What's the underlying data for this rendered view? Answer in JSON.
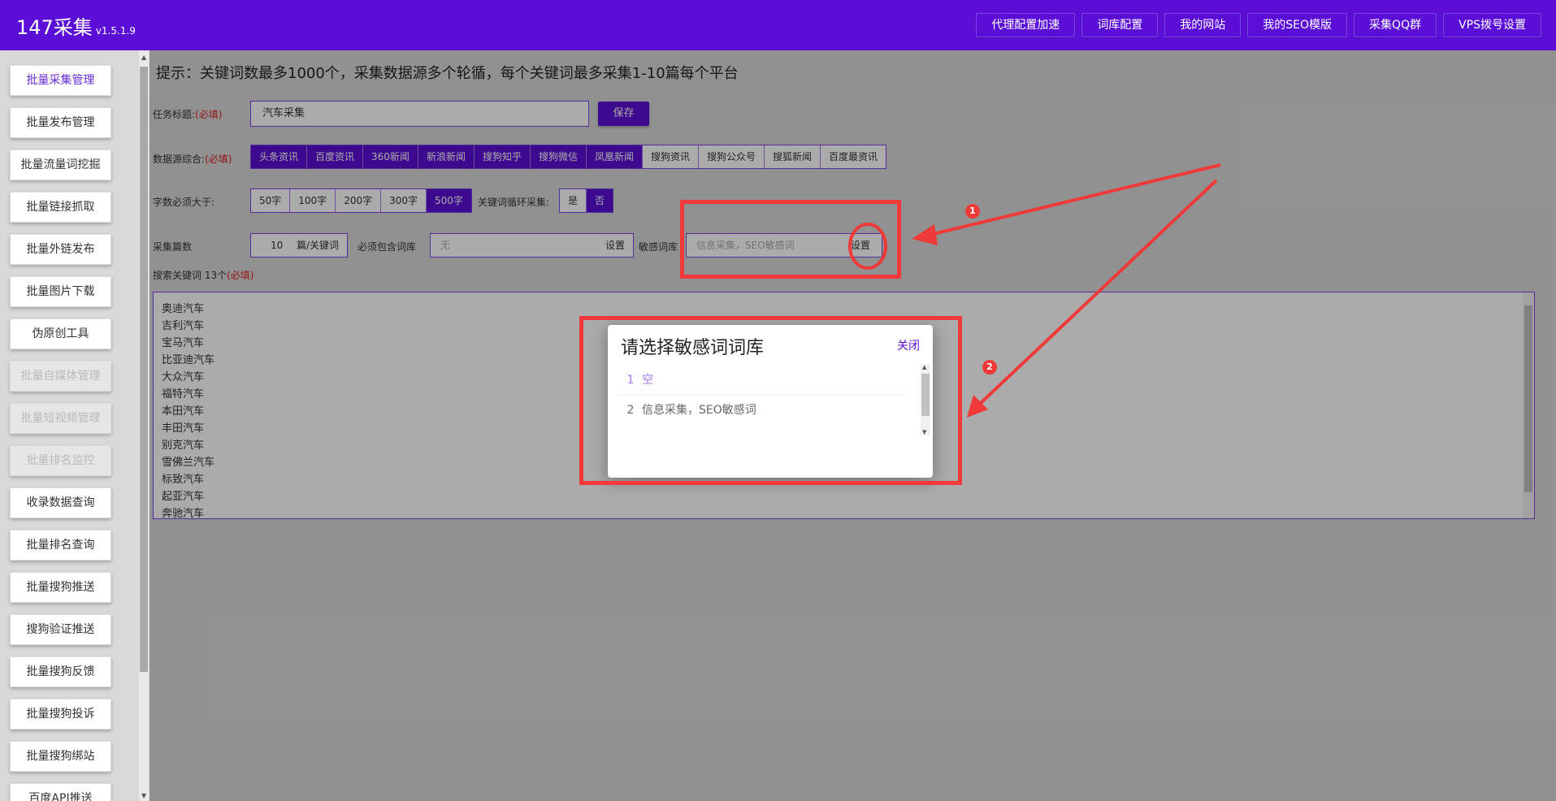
{
  "header": {
    "brand": "147采集",
    "version": "v1.5.1.9",
    "nav": [
      "代理配置加速",
      "词库配置",
      "我的网站",
      "我的SEO模版",
      "采集QQ群",
      "VPS拨号设置"
    ]
  },
  "sidebar": {
    "items": [
      {
        "label": "批量采集管理",
        "state": "active"
      },
      {
        "label": "批量发布管理",
        "state": "normal"
      },
      {
        "label": "批量流量词挖掘",
        "state": "normal"
      },
      {
        "label": "批量链接抓取",
        "state": "normal"
      },
      {
        "label": "批量外链发布",
        "state": "normal"
      },
      {
        "label": "批量图片下载",
        "state": "normal"
      },
      {
        "label": "伪原创工具",
        "state": "normal"
      },
      {
        "label": "批量自媒体管理",
        "state": "disabled"
      },
      {
        "label": "批量短视频管理",
        "state": "disabled"
      },
      {
        "label": "批量排名监控",
        "state": "disabled"
      },
      {
        "label": "收录数据查询",
        "state": "normal"
      },
      {
        "label": "批量排名查询",
        "state": "normal"
      },
      {
        "label": "批量搜狗推送",
        "state": "normal"
      },
      {
        "label": "搜狗验证推送",
        "state": "normal"
      },
      {
        "label": "批量搜狗反馈",
        "state": "normal"
      },
      {
        "label": "批量搜狗投诉",
        "state": "normal"
      },
      {
        "label": "批量搜狗绑站",
        "state": "normal"
      },
      {
        "label": "百度API推送",
        "state": "normal"
      }
    ]
  },
  "main": {
    "hint": "提示：关键词数最多1000个，采集数据源多个轮循，每个关键词最多采集1-10篇每个平台",
    "task_title_label": "任务标题:",
    "required": "(必填)",
    "task_title_value": "汽车采集",
    "save": "保存",
    "source_label": "数据源综合:",
    "sources": [
      {
        "label": "头条资讯",
        "on": true
      },
      {
        "label": "百度资讯",
        "on": true
      },
      {
        "label": "360新闻",
        "on": true
      },
      {
        "label": "新浪新闻",
        "on": true
      },
      {
        "label": "搜狗知乎",
        "on": true
      },
      {
        "label": "搜狗微信",
        "on": true
      },
      {
        "label": "凤凰新闻",
        "on": true
      },
      {
        "label": "搜狗资讯",
        "on": false
      },
      {
        "label": "搜狗公众号",
        "on": false
      },
      {
        "label": "搜狐新闻",
        "on": false
      },
      {
        "label": "百度最资讯",
        "on": false
      }
    ],
    "min_words_label": "字数必须大于:",
    "min_words": [
      {
        "label": "50字",
        "on": false
      },
      {
        "label": "100字",
        "on": false
      },
      {
        "label": "200字",
        "on": false
      },
      {
        "label": "300字",
        "on": false
      },
      {
        "label": "500字",
        "on": true
      }
    ],
    "loop_label": "关键词循环采集:",
    "loop": [
      {
        "label": "是",
        "on": false
      },
      {
        "label": "否",
        "on": true
      }
    ],
    "count_label": "采集篇数",
    "count_value": "10",
    "count_unit": "篇/关键词",
    "must_contain_label": "必须包含词库",
    "must_contain_value": "无",
    "set": "设置",
    "sensitive_label": "敏感词库",
    "sensitive_value": "信息采集，SEO敏感词",
    "keywords_label": "搜索关键词 13个",
    "keywords": [
      "奥迪汽车",
      "吉利汽车",
      "宝马汽车",
      "比亚迪汽车",
      "大众汽车",
      "福特汽车",
      "本田汽车",
      "丰田汽车",
      "别克汽车",
      "雪佛兰汽车",
      "标致汽车",
      "起亚汽车",
      "奔驰汽车"
    ]
  },
  "modal": {
    "title": "请选择敏感词词库",
    "close": "关闭",
    "items": [
      {
        "index": "1",
        "label": "空"
      },
      {
        "index": "2",
        "label": "信息采集，SEO敏感词"
      }
    ]
  },
  "annotations": {
    "badge1": "1",
    "badge2": "2",
    "color": "#f03a3a"
  }
}
